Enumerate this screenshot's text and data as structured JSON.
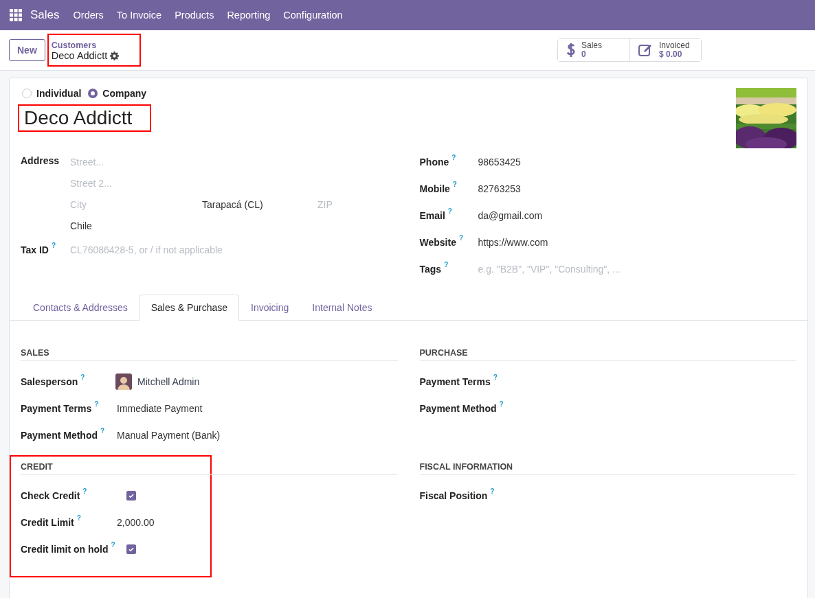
{
  "navbar": {
    "app": "Sales",
    "menu": [
      "Orders",
      "To Invoice",
      "Products",
      "Reporting",
      "Configuration"
    ]
  },
  "control_panel": {
    "new_button": "New",
    "breadcrumb": {
      "parent": "Customers",
      "current": "Deco Addictt",
      "highlighted": true
    },
    "stat_buttons": [
      {
        "kind": "sales",
        "label": "Sales",
        "value": "0"
      },
      {
        "kind": "invoiced",
        "label": "Invoiced",
        "value": "$ 0.00"
      }
    ]
  },
  "form": {
    "company_type": [
      {
        "label": "Individual",
        "selected": false
      },
      {
        "label": "Company",
        "selected": true
      }
    ],
    "name": {
      "value": "Deco Addictt",
      "highlighted": true
    },
    "address": {
      "label": "Address",
      "street": {
        "placeholder": "Street..."
      },
      "street2": {
        "placeholder": "Street 2..."
      },
      "city": {
        "placeholder": "City"
      },
      "state": {
        "value": "Tarapacá (CL)"
      },
      "zip": {
        "placeholder": "ZIP"
      },
      "country": {
        "value": "Chile"
      }
    },
    "left_fields": [
      {
        "label": "Tax ID",
        "tooltip": "?",
        "kind": "input",
        "placeholder": "CL76086428-5, or / if not applicable"
      }
    ],
    "right_fields": [
      {
        "label": "Phone",
        "tooltip": "?",
        "kind": "input",
        "value": "98653425"
      },
      {
        "label": "Mobile",
        "tooltip": "?",
        "kind": "input",
        "value": "82763253"
      },
      {
        "label": "Email",
        "tooltip": "?",
        "kind": "input",
        "value": "da@gmail.com"
      },
      {
        "label": "Website",
        "tooltip": "?",
        "kind": "input",
        "value": "https://www.com"
      },
      {
        "label": "Tags",
        "tooltip": "?",
        "kind": "input",
        "placeholder": "e.g. \"B2B\", \"VIP\", \"Consulting\", ..."
      }
    ],
    "tabs": [
      {
        "label": "Contacts & Addresses",
        "selected": false
      },
      {
        "label": "Sales & Purchase",
        "selected": true
      },
      {
        "label": "Invoicing",
        "selected": false
      },
      {
        "label": "Internal Notes",
        "selected": false
      }
    ],
    "sections": [
      {
        "title": "SALES",
        "highlighted": false,
        "fields": [
          {
            "label": "Salesperson",
            "tooltip": "?",
            "kind": "avatar",
            "value": "Mitchell Admin"
          },
          {
            "label": "Payment Terms",
            "tooltip": "?",
            "kind": "input",
            "value": "Immediate Payment"
          },
          {
            "label": "Payment Method",
            "tooltip": "?",
            "kind": "input",
            "value": "Manual Payment (Bank)"
          }
        ]
      },
      {
        "title": "PURCHASE",
        "highlighted": false,
        "fields": [
          {
            "label": "Payment Terms",
            "tooltip": "?",
            "kind": "input"
          },
          {
            "label": "Payment Method",
            "tooltip": "?",
            "kind": "input"
          }
        ]
      },
      {
        "title": "CREDIT",
        "highlighted": true,
        "fields": [
          {
            "label": "Check Credit",
            "tooltip": "?",
            "kind": "checkbox",
            "checked": true
          },
          {
            "label": "Credit Limit",
            "tooltip": "?",
            "kind": "input",
            "value": "2,000.00"
          },
          {
            "label": "Credit limit on hold",
            "tooltip": "?",
            "kind": "checkbox",
            "checked": true
          }
        ]
      },
      {
        "title": "FISCAL INFORMATION",
        "highlighted": false,
        "fields": [
          {
            "label": "Fiscal Position",
            "tooltip": "?",
            "kind": "input"
          }
        ]
      }
    ]
  }
}
